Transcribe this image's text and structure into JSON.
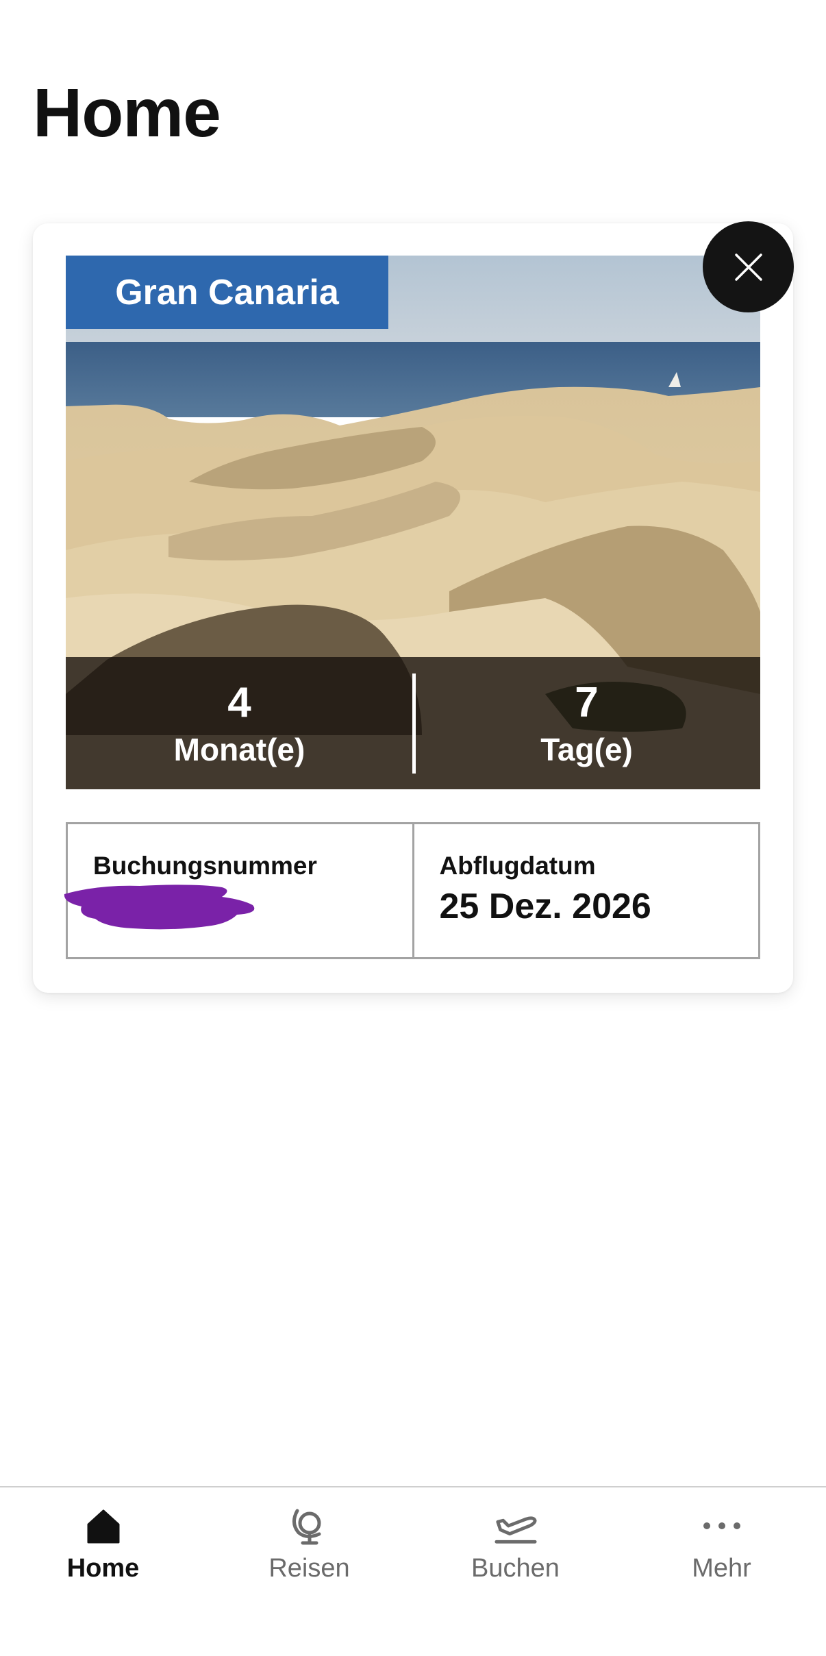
{
  "page": {
    "title": "Home"
  },
  "trip": {
    "destination": "Gran Canaria",
    "countdown": {
      "months_value": "4",
      "months_label": "Monat(e)",
      "days_value": "7",
      "days_label": "Tag(e)"
    },
    "booking_number_label": "Buchungsnummer",
    "booking_number_value": "",
    "departure_label": "Abflugdatum",
    "departure_value": "25 Dez. 2026"
  },
  "colors": {
    "badge": "#2e68ae",
    "redaction": "#7a22a8",
    "close_button": "#141414"
  },
  "tabbar": {
    "items": [
      {
        "label": "Home",
        "icon": "home-icon",
        "active": true
      },
      {
        "label": "Reisen",
        "icon": "globe-icon",
        "active": false
      },
      {
        "label": "Buchen",
        "icon": "plane-departure-icon",
        "active": false
      },
      {
        "label": "Mehr",
        "icon": "more-dots-icon",
        "active": false
      }
    ]
  }
}
